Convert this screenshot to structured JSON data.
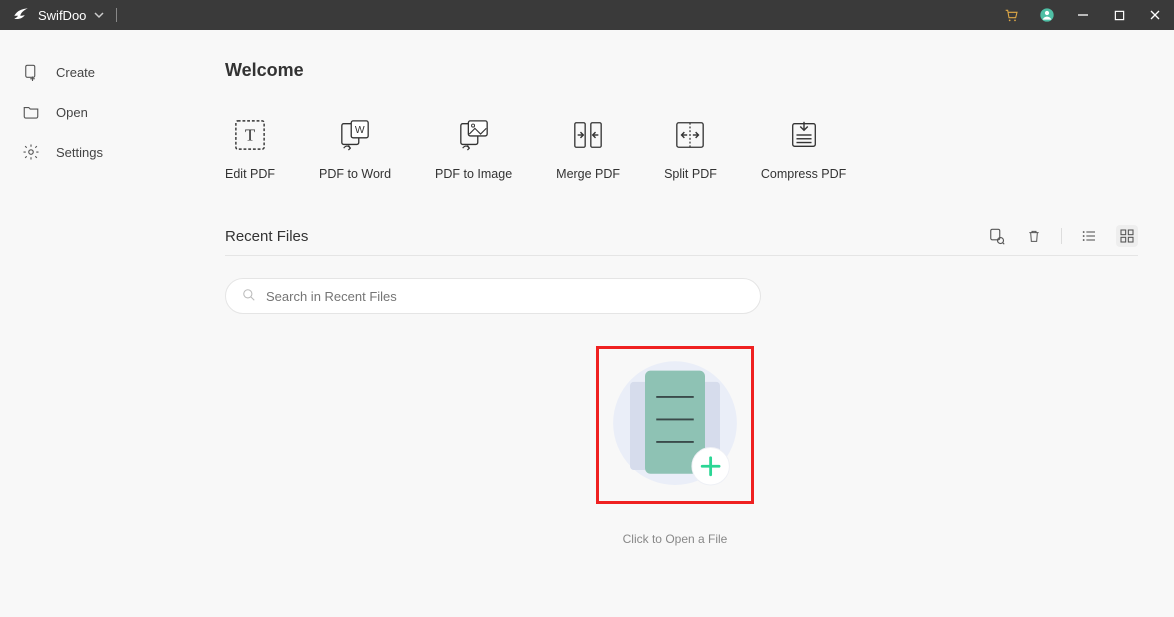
{
  "titlebar": {
    "brand": "SwifDoo"
  },
  "sidebar": {
    "items": [
      {
        "label": "Create"
      },
      {
        "label": "Open"
      },
      {
        "label": "Settings"
      }
    ]
  },
  "welcome": "Welcome",
  "quick_actions": [
    {
      "label": "Edit PDF"
    },
    {
      "label": "PDF to Word"
    },
    {
      "label": "PDF to Image"
    },
    {
      "label": "Merge PDF"
    },
    {
      "label": "Split PDF"
    },
    {
      "label": "Compress PDF"
    }
  ],
  "recent": {
    "title": "Recent Files",
    "search_placeholder": "Search in Recent Files",
    "open_caption": "Click to Open a File"
  }
}
